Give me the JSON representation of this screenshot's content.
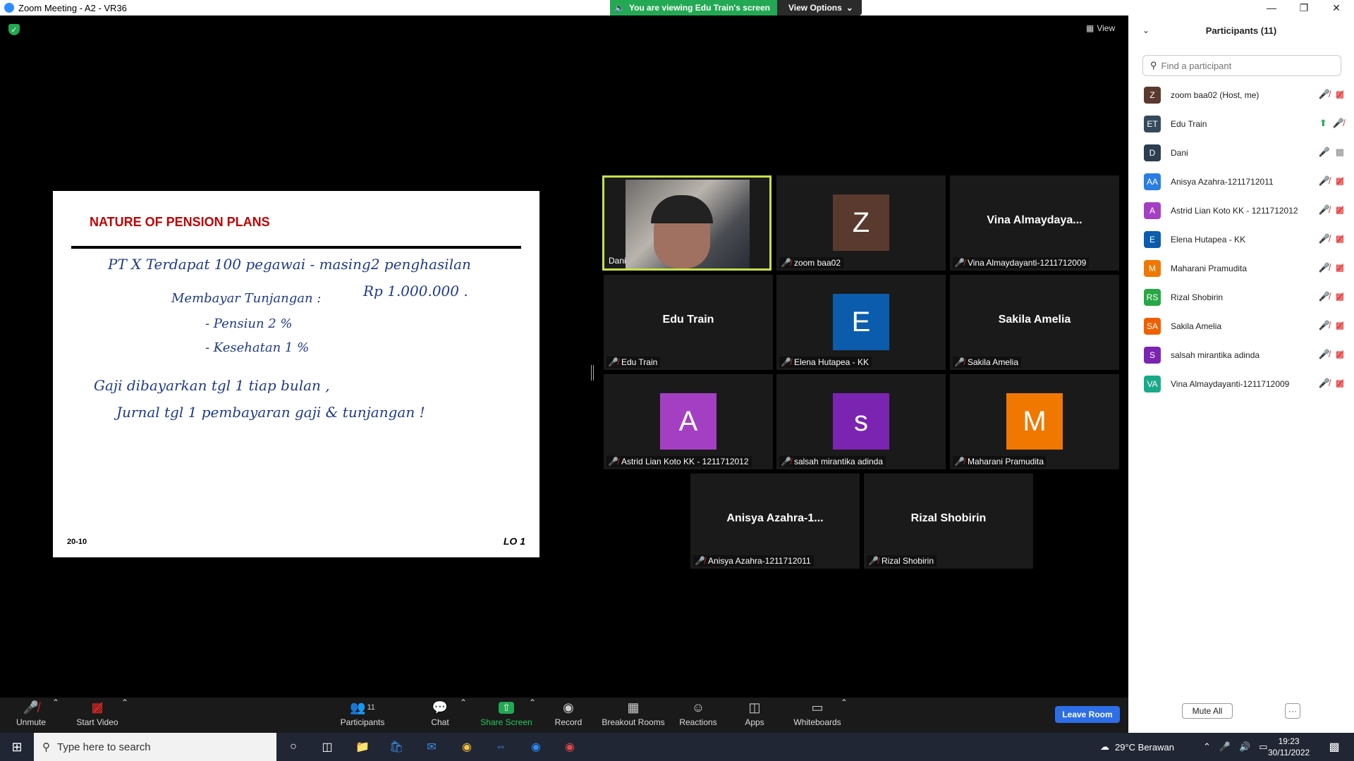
{
  "window": {
    "title": "Zoom Meeting - A2 - VR36"
  },
  "banner": {
    "viewing": "You are viewing Edu Train's screen",
    "view_options": "View Options"
  },
  "view_label": "View",
  "slide": {
    "title": "NATURE OF PENSION PLANS",
    "footer_left": "20-10",
    "footer_right": "LO 1",
    "handwriting": [
      "PT X  Terdapat 100 pegawai - masing2 penghasilan",
      "Rp 1.000.000 .",
      "Membayar Tunjangan :",
      "- Pensiun  2 %",
      "- Kesehatan  1 %",
      "Gaji dibayarkan tgl 1 tiap bulan ,",
      "Jurnal tgl 1 pembayaran gaji & tunjangan !"
    ]
  },
  "tiles": [
    {
      "name": "Dani",
      "type": "video"
    },
    {
      "name": "zoom baa02",
      "type": "avatar",
      "initial": "Z",
      "color": "#5a3a2e"
    },
    {
      "name": "Vina Almaydayanti-1211712009",
      "type": "text",
      "center": "Vina  Almaydaya..."
    },
    {
      "name": "Edu Train",
      "type": "text",
      "center": "Edu Train"
    },
    {
      "name": "Elena Hutapea - KK",
      "type": "avatar",
      "initial": "E",
      "color": "#0b5cad"
    },
    {
      "name": "Sakila Amelia",
      "type": "text",
      "center": "Sakila Amelia"
    },
    {
      "name": "Astrid Lian Koto KK - 1211712012",
      "type": "avatar",
      "initial": "A",
      "color": "#a43fc4"
    },
    {
      "name": "salsah mirantika adinda",
      "type": "avatar",
      "initial": "s",
      "color": "#7b24b2"
    },
    {
      "name": "Maharani Pramudita",
      "type": "avatar",
      "initial": "M",
      "color": "#f07800"
    },
    {
      "name": "Anisya Azahra-1211712011",
      "type": "text",
      "center": "Anisya  Azahra-1..."
    },
    {
      "name": "Rizal Shobirin",
      "type": "text",
      "center": "Rizal Shobirin"
    }
  ],
  "panel": {
    "title": "Participants (11)",
    "search_placeholder": "Find a participant",
    "participants": [
      {
        "initials": "Z",
        "name": "zoom baa02 (Host, me)",
        "color": "#5a3a2e",
        "mic": "muted",
        "video": "off"
      },
      {
        "initials": "ET",
        "name": "Edu Train",
        "color": "#34495e",
        "mic": "muted",
        "video": "sharing"
      },
      {
        "initials": "D",
        "name": "Dani",
        "color": "#2c3e50",
        "mic": "on",
        "video": "on"
      },
      {
        "initials": "AA",
        "name": "Anisya Azahra-1211712011",
        "color": "#2a7de1",
        "mic": "muted",
        "video": "off"
      },
      {
        "initials": "A",
        "name": "Astrid Lian Koto KK - 1211712012",
        "color": "#a43fc4",
        "mic": "muted",
        "video": "off"
      },
      {
        "initials": "E",
        "name": "Elena Hutapea - KK",
        "color": "#0b5cad",
        "mic": "muted",
        "video": "off"
      },
      {
        "initials": "M",
        "name": "Maharani Pramudita",
        "color": "#f07800",
        "mic": "muted",
        "video": "off"
      },
      {
        "initials": "RS",
        "name": "Rizal Shobirin",
        "color": "#27a844",
        "mic": "muted",
        "video": "off"
      },
      {
        "initials": "SA",
        "name": "Sakila Amelia",
        "color": "#f06000",
        "mic": "muted",
        "video": "off"
      },
      {
        "initials": "S",
        "name": "salsah mirantika adinda",
        "color": "#7b24b2",
        "mic": "muted",
        "video": "off"
      },
      {
        "initials": "VA",
        "name": "Vina Almaydayanti-1211712009",
        "color": "#1aa88a",
        "mic": "muted",
        "video": "off"
      }
    ],
    "mute_all": "Mute All",
    "more": "···"
  },
  "toolbar": {
    "unmute": "Unmute",
    "start_video": "Start Video",
    "participants": "Participants",
    "participants_count": "11",
    "chat": "Chat",
    "share_screen": "Share Screen",
    "record": "Record",
    "breakout": "Breakout Rooms",
    "reactions": "Reactions",
    "apps": "Apps",
    "whiteboards": "Whiteboards",
    "leave": "Leave Room"
  },
  "taskbar": {
    "search_placeholder": "Type here to search",
    "weather": "29°C  Berawan",
    "time": "19:23",
    "date": "30/11/2022"
  }
}
